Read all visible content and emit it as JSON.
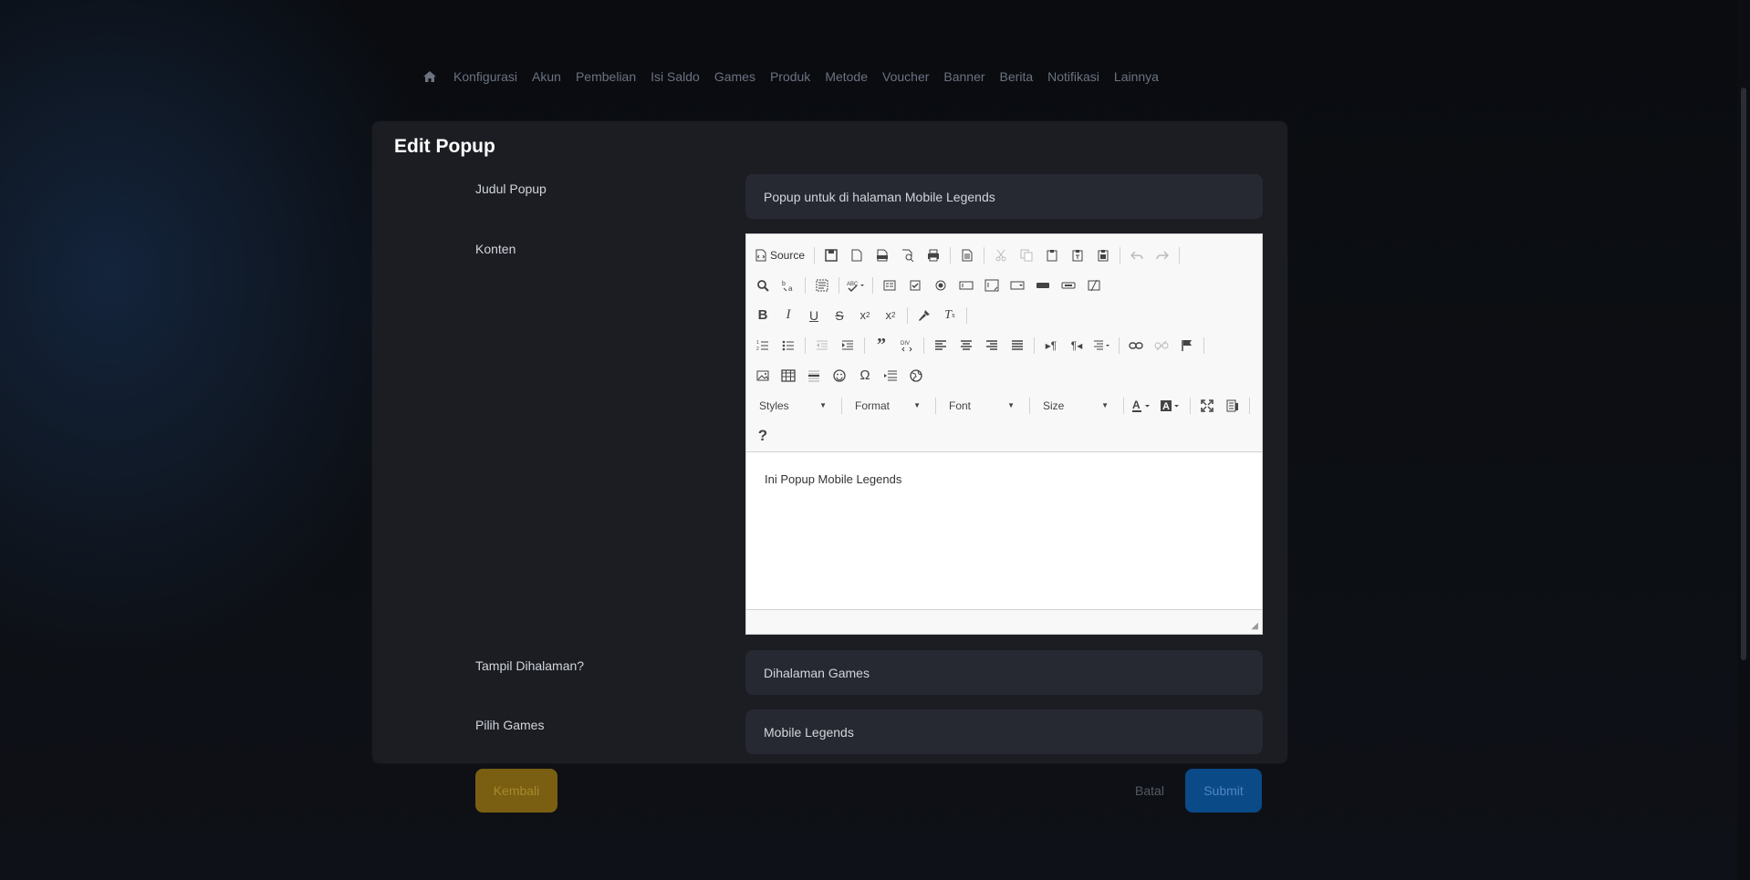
{
  "nav": {
    "home_icon": "home-icon",
    "items": [
      "Konfigurasi",
      "Akun",
      "Pembelian",
      "Isi Saldo",
      "Games",
      "Produk",
      "Metode",
      "Voucher",
      "Banner",
      "Berita",
      "Notifikasi",
      "Lainnya"
    ]
  },
  "card": {
    "title": "Edit Popup",
    "judul_label": "Judul Popup",
    "judul_value": "Popup untuk di halaman Mobile Legends",
    "konten_label": "Konten",
    "tampil_label": "Tampil Dihalaman?",
    "tampil_value": "Dihalaman Games",
    "games_label": "Pilih Games",
    "games_value": "Mobile Legends"
  },
  "editor": {
    "source_label": "Source",
    "styles_label": "Styles",
    "format_label": "Format",
    "font_label": "Font",
    "size_label": "Size",
    "content": "Ini Popup Mobile Legends"
  },
  "buttons": {
    "back": "Kembali",
    "cancel": "Batal",
    "submit": "Submit"
  },
  "colors": {
    "background": "#0b0d12",
    "card": "#1b1d23",
    "field": "#262931",
    "back_button": "#7a5e12",
    "submit_button": "#0a4a87"
  }
}
